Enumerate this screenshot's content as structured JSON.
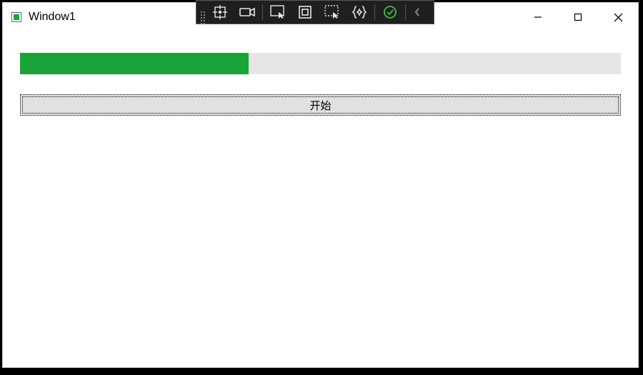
{
  "window": {
    "title": "Window1"
  },
  "progress": {
    "percent": 38
  },
  "buttons": {
    "start_label": "开始"
  },
  "devToolbar": {
    "items": [
      {
        "name": "target-icon"
      },
      {
        "name": "camera-icon"
      },
      {
        "name": "cursor-select-icon"
      },
      {
        "name": "layout-icon"
      },
      {
        "name": "inspect-icon"
      },
      {
        "name": "braces-icon"
      },
      {
        "name": "check-icon"
      },
      {
        "name": "chevron-left-icon"
      }
    ]
  }
}
